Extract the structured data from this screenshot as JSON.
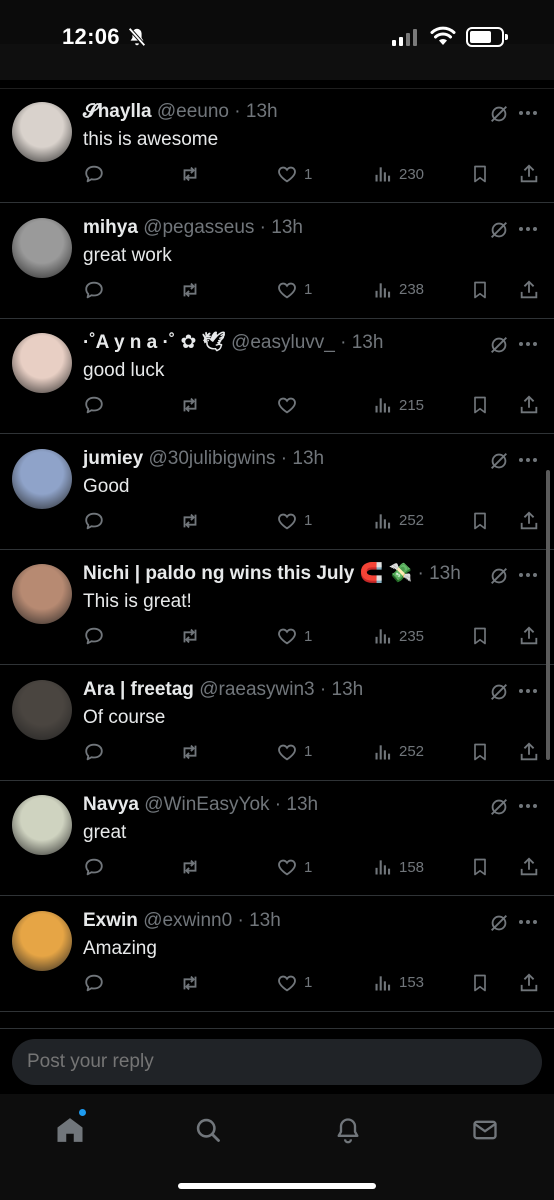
{
  "status_bar": {
    "time": "12:06"
  },
  "replies": [
    {
      "name": "𝓢haylla",
      "handle": "@eeuno",
      "time": "13h",
      "text": "this is awesome",
      "likes": "1",
      "views": "230",
      "avatar_color": "#d9d2cc"
    },
    {
      "name": "mihya",
      "handle": "@pegasseus",
      "time": "13h",
      "text": "great work",
      "likes": "1",
      "views": "238",
      "avatar_color": "#9a9a9a"
    },
    {
      "name": "·˚A y n a ·˚ ✿ 🕊",
      "handle": "@easyluvv_",
      "time": "13h",
      "text": "good luck",
      "likes": "",
      "views": "215",
      "avatar_color": "#e8cfc4"
    },
    {
      "name": "jumiey",
      "handle": "@30julibigwins",
      "time": "13h",
      "text": "Good",
      "likes": "1",
      "views": "252",
      "avatar_color": "#8fa3c9"
    },
    {
      "name": "Nichi | paldo ng wins this July 🧲 💸",
      "handle": "",
      "time": "13h",
      "text": "This is great!",
      "likes": "1",
      "views": "235",
      "avatar_color": "#b78a72"
    },
    {
      "name": "Ara | freetag",
      "handle": "@raeasywin3",
      "time": "13h",
      "text": "Of course",
      "likes": "1",
      "views": "252",
      "avatar_color": "#4a4540"
    },
    {
      "name": "Navya",
      "handle": "@WinEasyYok",
      "time": "13h",
      "text": "great",
      "likes": "1",
      "views": "158",
      "avatar_color": "#cfd3c0"
    },
    {
      "name": "Exwin",
      "handle": "@exwinn0",
      "time": "13h",
      "text": "Amazing",
      "likes": "1",
      "views": "153",
      "avatar_color": "#e6a545"
    }
  ],
  "reply_box": {
    "placeholder": "Post your reply"
  },
  "colors": {
    "accent": "#1d9bf0",
    "muted": "#71767b",
    "background": "#000000",
    "text": "#e7e9ea"
  }
}
